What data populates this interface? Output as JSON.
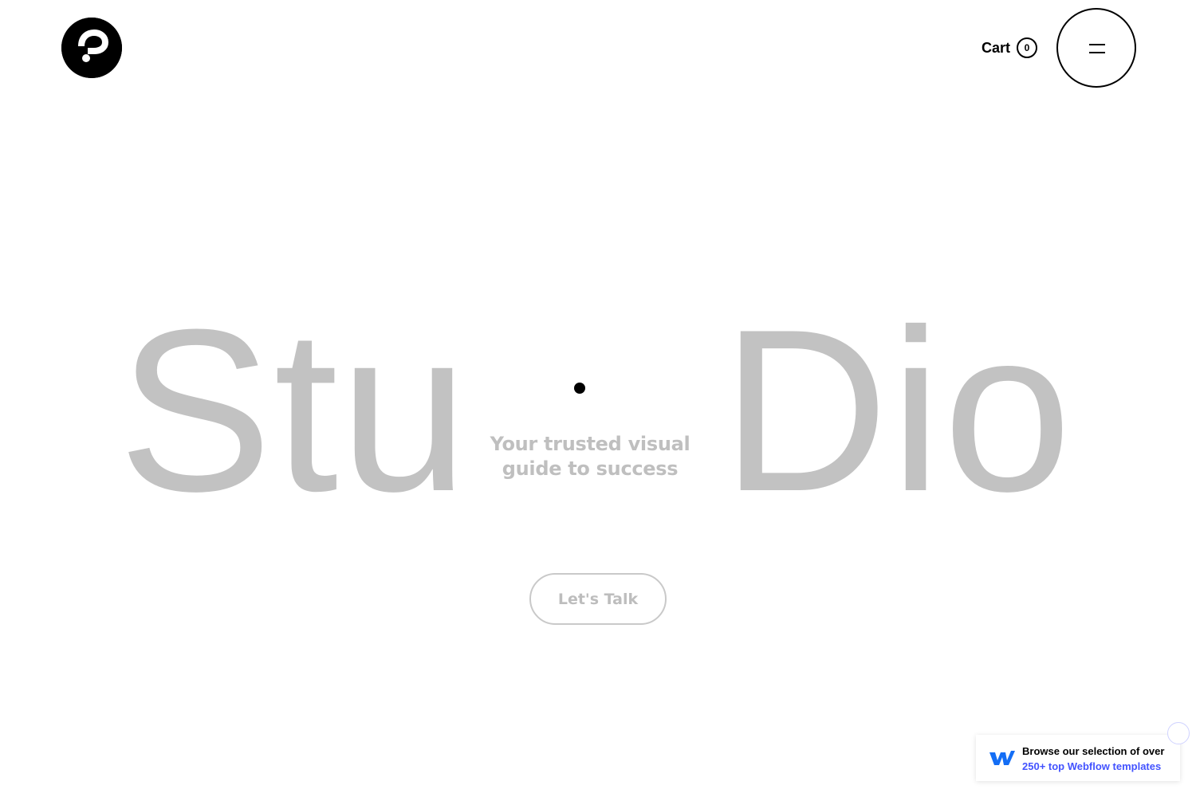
{
  "header": {
    "logo_icon": "brand-logo-icon",
    "cart_label": "Cart",
    "cart_count": "0",
    "menu_icon": "hamburger-menu-icon"
  },
  "hero": {
    "word_left": "Stu",
    "word_right": "Dio",
    "tagline_line1": "Your trusted visual",
    "tagline_line2": "guide to success",
    "cta_label": "Let's Talk"
  },
  "badge": {
    "line1": "Browse our selection of over",
    "line2": "250+ top Webflow templates",
    "logo_icon": "webflow-logo-icon",
    "close_icon": "close-icon"
  },
  "colors": {
    "hero_text": "#c2c2c2",
    "accent_link": "#4353ff",
    "webflow_blue": "#146ef5",
    "foreground": "#000000",
    "background": "#ffffff"
  }
}
